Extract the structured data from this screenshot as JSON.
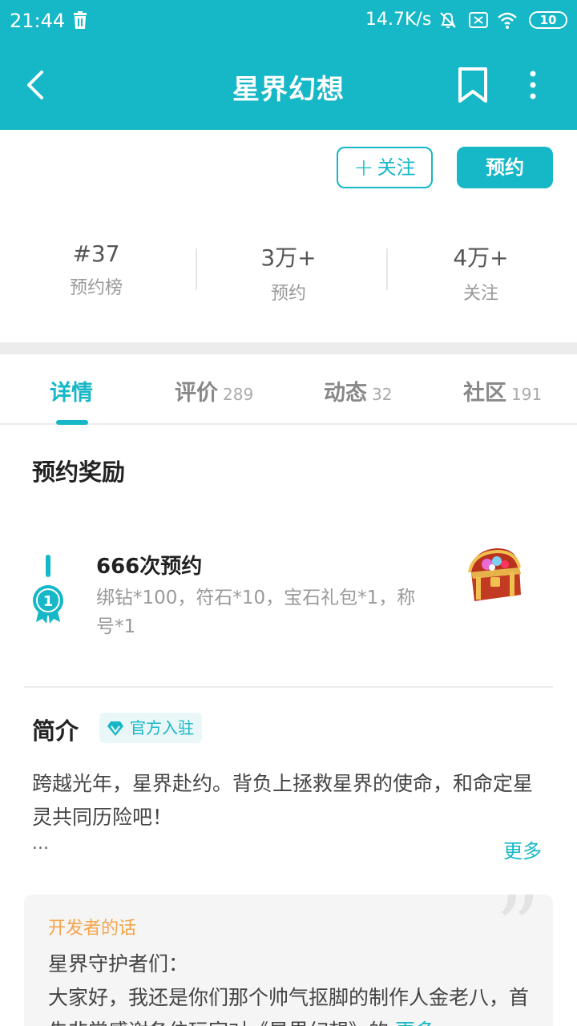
{
  "status_bar": {
    "time": "21:44",
    "net_speed": "14.7K/s",
    "battery": "10",
    "icons": [
      "trash-icon",
      "bell-muted-icon",
      "close-box-icon",
      "wifi-icon",
      "battery-icon"
    ]
  },
  "app_bar": {
    "title": "星界幻想",
    "icons": [
      "back-icon",
      "bookmark-icon",
      "more-vert-icon"
    ]
  },
  "actions": {
    "follow_label": "关注",
    "reserve_label": "预约"
  },
  "stats": [
    {
      "value": "#37",
      "label": "预约榜"
    },
    {
      "value": "3万+",
      "label": "预约"
    },
    {
      "value": "4万+",
      "label": "关注"
    }
  ],
  "tabs": [
    {
      "label": "详情",
      "count": ""
    },
    {
      "label": "评价",
      "count": "289"
    },
    {
      "label": "动态",
      "count": "32"
    },
    {
      "label": "社区",
      "count": "191"
    }
  ],
  "reward": {
    "section_title": "预约奖励",
    "medal_number": "1",
    "name": "666次预约",
    "desc": "绑钻*100，符石*10，宝石礼包*1，称号*1"
  },
  "intro": {
    "section_title": "简介",
    "badge": "官方入驻",
    "text": "跨越光年，星界赴约。背负上拯救星界的使命，和命定星灵共同历险吧！",
    "ellipsis": "...",
    "more": "更多"
  },
  "developer": {
    "title": "开发者的话",
    "line1": "星界守护者们：",
    "line2": "大家好，我还是你们那个帅气抠脚的制作人金老八，首先非常感谢各位玩家对《星界幻想》的",
    "more": "更多"
  },
  "colors": {
    "accent": "#16b7c6",
    "dev_title": "#f5a44a",
    "gap": "#ececec"
  }
}
